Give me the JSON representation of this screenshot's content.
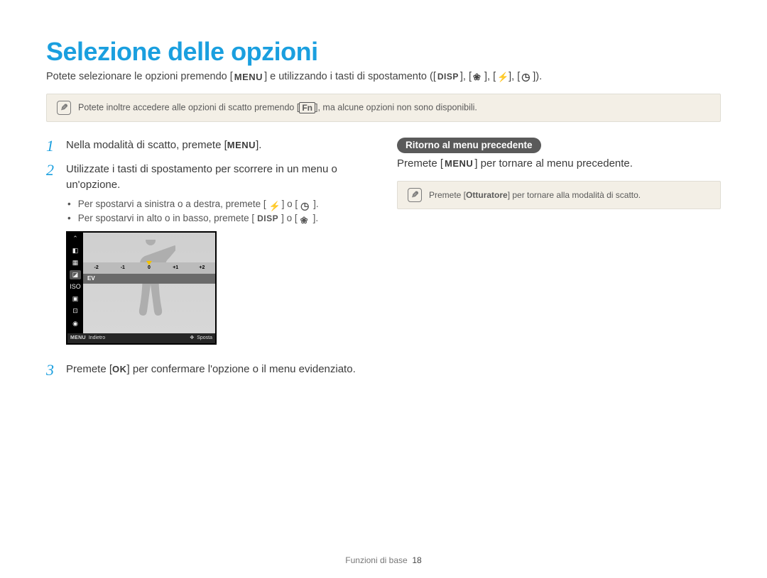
{
  "title": "Selezione delle opzioni",
  "subtitle": {
    "pre": "Potete selezionare le opzioni premendo [",
    "menu": "MENU",
    "mid": "] e utilizzando i tasti di spostamento ([",
    "disp": "DISP",
    "sep1": "], [",
    "sep2": "], [",
    "sep3": "], [",
    "end": "])."
  },
  "note1": {
    "pre": "Potete inoltre accedere alle opzioni di scatto premendo [",
    "fn": "Fn",
    "post": "], ma alcune opzioni non sono disponibili."
  },
  "steps": [
    {
      "num": "1",
      "text_pre": "Nella modalità di scatto, premete [",
      "key": "MENU",
      "text_post": "]."
    },
    {
      "num": "2",
      "text": "Utilizzate i tasti di spostamento per scorrere in un menu o un'opzione."
    },
    {
      "num": "3",
      "text_pre": "Premete [",
      "key": "OK",
      "text_post": "] per confermare l'opzione o il menu evidenziato."
    }
  ],
  "sub_bullets": {
    "a_pre": "Per spostarvi a sinistra o a destra, premete [",
    "a_mid": "] o [",
    "a_post": "].",
    "b_pre": "Per spostarvi in alto o in basso, premete [",
    "b_key": "DISP",
    "b_mid": "] o [",
    "b_post": "]."
  },
  "camera": {
    "ruler": [
      "-2",
      "-1",
      "0",
      "+1",
      "+2"
    ],
    "ev": "EV",
    "bottom_menu": "MENU",
    "bottom_back": "Indietro",
    "bottom_move": "Sposta"
  },
  "right_col": {
    "pill": "Ritorno al menu precedente",
    "line_pre": "Premete [",
    "line_key": "MENU",
    "line_post": "] per tornare al menu precedente.",
    "note_pre": "Premete [",
    "note_bold": "Otturatore",
    "note_post": "] per tornare alla modalità di scatto."
  },
  "footer": {
    "section": "Funzioni di base",
    "page": "18"
  }
}
